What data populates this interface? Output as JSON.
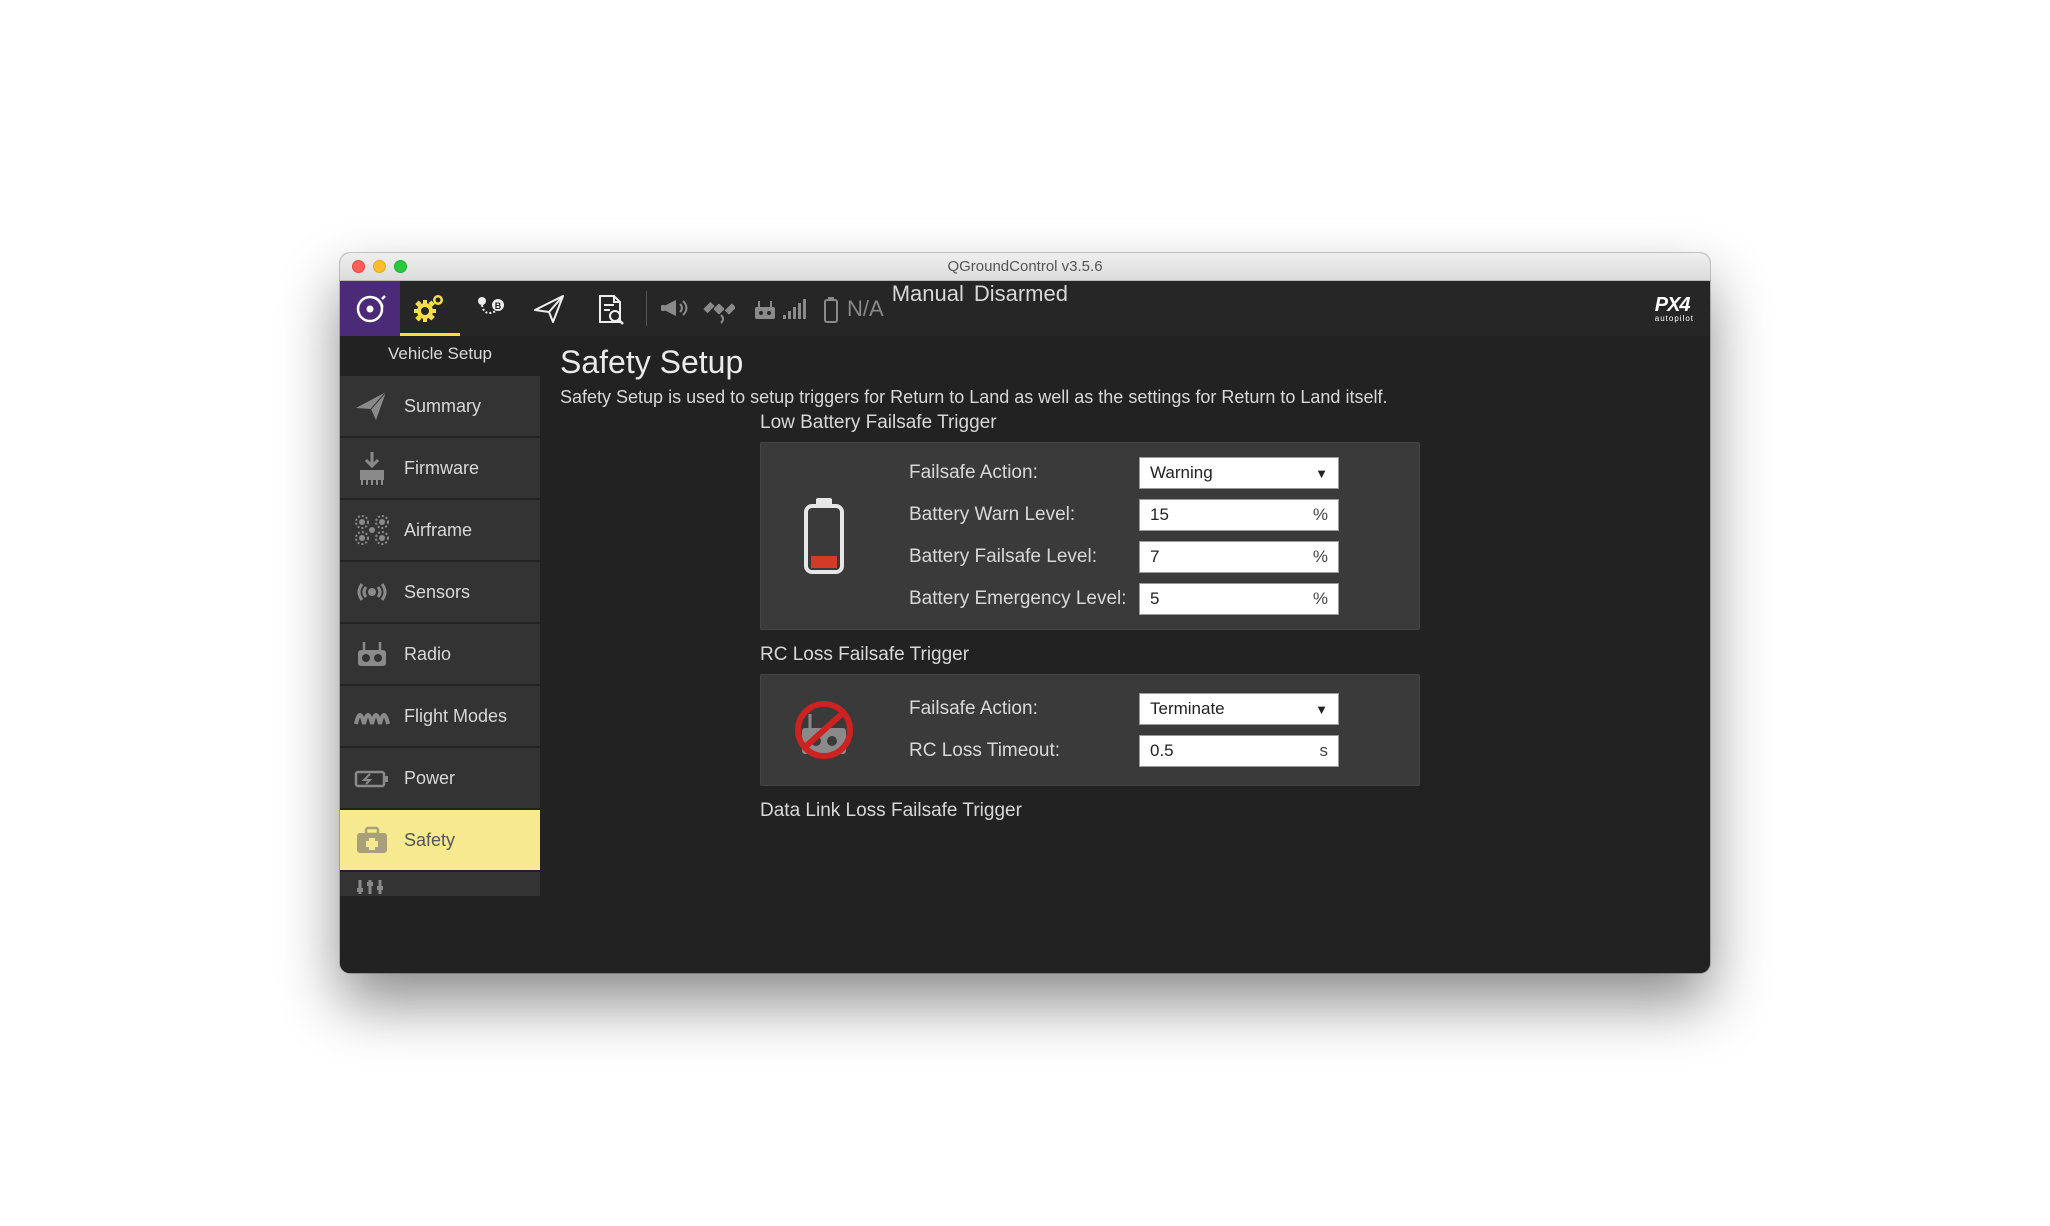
{
  "window": {
    "title": "QGroundControl v3.5.6"
  },
  "toolbar": {
    "battery_text": "N/A",
    "mode": "Manual",
    "arm_state": "Disarmed",
    "logo_main": "PX4",
    "logo_sub": "autopilot"
  },
  "sidebar": {
    "header": "Vehicle Setup",
    "items": [
      {
        "label": "Summary"
      },
      {
        "label": "Firmware"
      },
      {
        "label": "Airframe"
      },
      {
        "label": "Sensors"
      },
      {
        "label": "Radio"
      },
      {
        "label": "Flight Modes"
      },
      {
        "label": "Power"
      },
      {
        "label": "Safety"
      }
    ]
  },
  "page": {
    "title": "Safety Setup",
    "description": "Safety Setup is used to setup triggers for Return to Land as well as the settings for Return to Land itself."
  },
  "sections": {
    "low_battery": {
      "title": "Low Battery Failsafe Trigger",
      "action_label": "Failsafe Action:",
      "action_value": "Warning",
      "warn_label": "Battery Warn Level:",
      "warn_value": "15",
      "warn_unit": "%",
      "failsafe_label": "Battery Failsafe Level:",
      "failsafe_value": "7",
      "failsafe_unit": "%",
      "emerg_label": "Battery Emergency Level:",
      "emerg_value": "5",
      "emerg_unit": "%"
    },
    "rc_loss": {
      "title": "RC Loss Failsafe Trigger",
      "action_label": "Failsafe Action:",
      "action_value": "Terminate",
      "timeout_label": "RC Loss Timeout:",
      "timeout_value": "0.5",
      "timeout_unit": "s"
    },
    "data_link": {
      "title": "Data Link Loss Failsafe Trigger"
    }
  }
}
